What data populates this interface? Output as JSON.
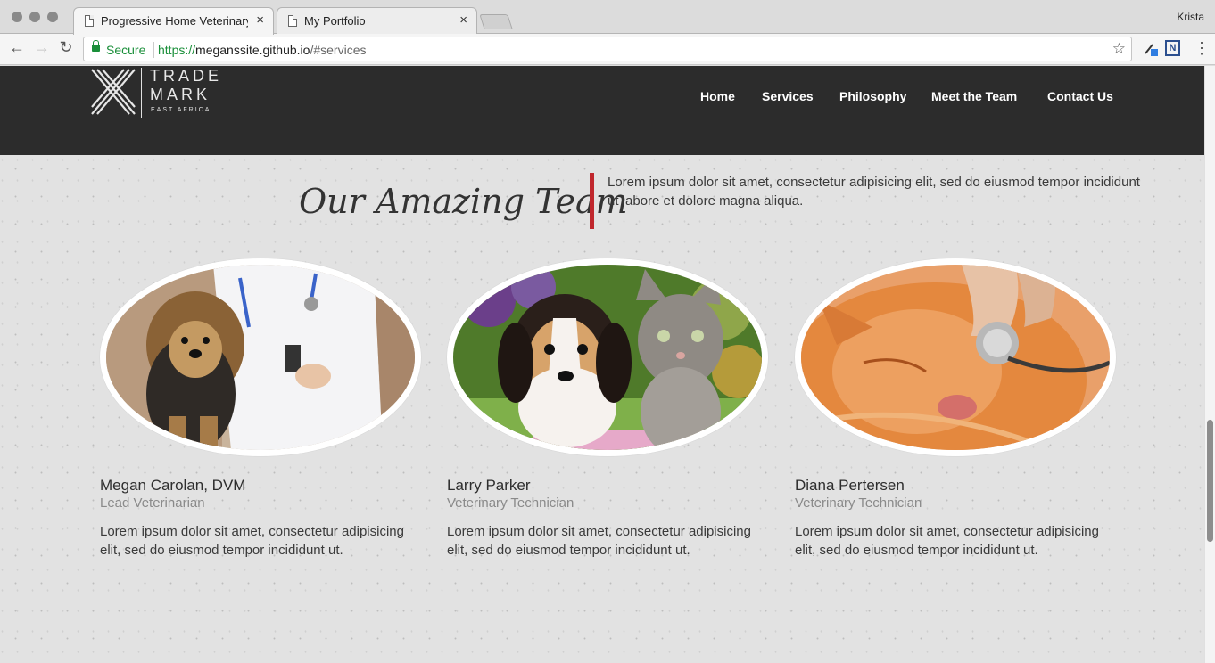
{
  "browser": {
    "tabs": [
      {
        "title": "Progressive Home Veterinary C",
        "close": "×"
      },
      {
        "title": "My Portfolio",
        "close": "×"
      }
    ],
    "profile_name": "Krista",
    "security_label": "Secure",
    "url_scheme": "https://",
    "url_host": "meganssite.github.io",
    "url_path": "/#services",
    "extension_label": "N"
  },
  "site": {
    "logo": {
      "line1": "TRADE",
      "line2": "MARK",
      "line3": "EAST AFRICA"
    },
    "nav": [
      "Home",
      "Services",
      "Philosophy",
      "Meet the Team",
      "Contact Us"
    ],
    "section_title": "Our Amazing Team",
    "section_intro": "Lorem ipsum dolor sit amet, consectetur adipisicing elit, sed do eiusmod tempor incididunt ut labore et dolore magna aliqua.",
    "team": [
      {
        "name": "Megan Carolan, DVM",
        "role": "Lead Veterinarian",
        "bio": "Lorem ipsum dolor sit amet, consectetur adipisicing elit, sed do eiusmod tempor incididunt ut.",
        "photo": "vet-with-yorkie-photo"
      },
      {
        "name": "Larry Parker",
        "role": "Veterinary Technician",
        "bio": "Lorem ipsum dolor sit amet, consectetur adipisicing elit, sed do eiusmod tempor incididunt ut.",
        "photo": "puppy-and-kitten-photo"
      },
      {
        "name": "Diana Pertersen",
        "role": "Veterinary Technician",
        "bio": "Lorem ipsum dolor sit amet, consectetur adipisicing elit, sed do eiusmod tempor incididunt ut.",
        "photo": "cat-with-stethoscope-photo"
      }
    ]
  },
  "colors": {
    "header_bg": "#2c2c2c",
    "accent_red": "#c0272d",
    "secure_green": "#1a8f3a"
  }
}
